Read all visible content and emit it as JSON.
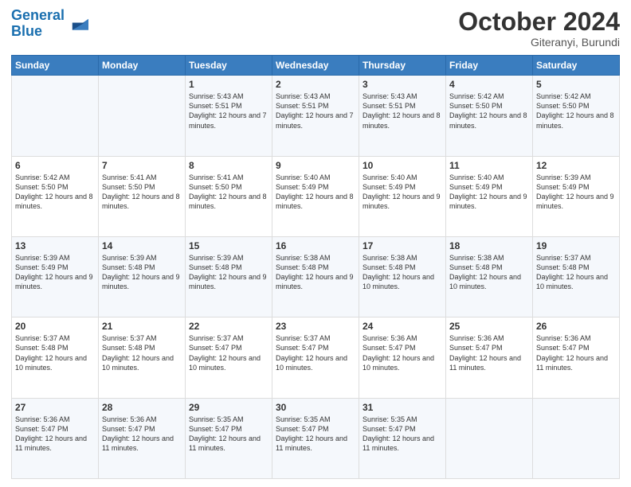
{
  "logo": {
    "line1": "General",
    "line2": "Blue"
  },
  "header": {
    "month": "October 2024",
    "location": "Giteranyi, Burundi"
  },
  "days_of_week": [
    "Sunday",
    "Monday",
    "Tuesday",
    "Wednesday",
    "Thursday",
    "Friday",
    "Saturday"
  ],
  "weeks": [
    [
      {
        "day": "",
        "info": ""
      },
      {
        "day": "",
        "info": ""
      },
      {
        "day": "1",
        "info": "Sunrise: 5:43 AM\nSunset: 5:51 PM\nDaylight: 12 hours and 7 minutes."
      },
      {
        "day": "2",
        "info": "Sunrise: 5:43 AM\nSunset: 5:51 PM\nDaylight: 12 hours and 7 minutes."
      },
      {
        "day": "3",
        "info": "Sunrise: 5:43 AM\nSunset: 5:51 PM\nDaylight: 12 hours and 8 minutes."
      },
      {
        "day": "4",
        "info": "Sunrise: 5:42 AM\nSunset: 5:50 PM\nDaylight: 12 hours and 8 minutes."
      },
      {
        "day": "5",
        "info": "Sunrise: 5:42 AM\nSunset: 5:50 PM\nDaylight: 12 hours and 8 minutes."
      }
    ],
    [
      {
        "day": "6",
        "info": "Sunrise: 5:42 AM\nSunset: 5:50 PM\nDaylight: 12 hours and 8 minutes."
      },
      {
        "day": "7",
        "info": "Sunrise: 5:41 AM\nSunset: 5:50 PM\nDaylight: 12 hours and 8 minutes."
      },
      {
        "day": "8",
        "info": "Sunrise: 5:41 AM\nSunset: 5:50 PM\nDaylight: 12 hours and 8 minutes."
      },
      {
        "day": "9",
        "info": "Sunrise: 5:40 AM\nSunset: 5:49 PM\nDaylight: 12 hours and 8 minutes."
      },
      {
        "day": "10",
        "info": "Sunrise: 5:40 AM\nSunset: 5:49 PM\nDaylight: 12 hours and 9 minutes."
      },
      {
        "day": "11",
        "info": "Sunrise: 5:40 AM\nSunset: 5:49 PM\nDaylight: 12 hours and 9 minutes."
      },
      {
        "day": "12",
        "info": "Sunrise: 5:39 AM\nSunset: 5:49 PM\nDaylight: 12 hours and 9 minutes."
      }
    ],
    [
      {
        "day": "13",
        "info": "Sunrise: 5:39 AM\nSunset: 5:49 PM\nDaylight: 12 hours and 9 minutes."
      },
      {
        "day": "14",
        "info": "Sunrise: 5:39 AM\nSunset: 5:48 PM\nDaylight: 12 hours and 9 minutes."
      },
      {
        "day": "15",
        "info": "Sunrise: 5:39 AM\nSunset: 5:48 PM\nDaylight: 12 hours and 9 minutes."
      },
      {
        "day": "16",
        "info": "Sunrise: 5:38 AM\nSunset: 5:48 PM\nDaylight: 12 hours and 9 minutes."
      },
      {
        "day": "17",
        "info": "Sunrise: 5:38 AM\nSunset: 5:48 PM\nDaylight: 12 hours and 10 minutes."
      },
      {
        "day": "18",
        "info": "Sunrise: 5:38 AM\nSunset: 5:48 PM\nDaylight: 12 hours and 10 minutes."
      },
      {
        "day": "19",
        "info": "Sunrise: 5:37 AM\nSunset: 5:48 PM\nDaylight: 12 hours and 10 minutes."
      }
    ],
    [
      {
        "day": "20",
        "info": "Sunrise: 5:37 AM\nSunset: 5:48 PM\nDaylight: 12 hours and 10 minutes."
      },
      {
        "day": "21",
        "info": "Sunrise: 5:37 AM\nSunset: 5:48 PM\nDaylight: 12 hours and 10 minutes."
      },
      {
        "day": "22",
        "info": "Sunrise: 5:37 AM\nSunset: 5:47 PM\nDaylight: 12 hours and 10 minutes."
      },
      {
        "day": "23",
        "info": "Sunrise: 5:37 AM\nSunset: 5:47 PM\nDaylight: 12 hours and 10 minutes."
      },
      {
        "day": "24",
        "info": "Sunrise: 5:36 AM\nSunset: 5:47 PM\nDaylight: 12 hours and 10 minutes."
      },
      {
        "day": "25",
        "info": "Sunrise: 5:36 AM\nSunset: 5:47 PM\nDaylight: 12 hours and 11 minutes."
      },
      {
        "day": "26",
        "info": "Sunrise: 5:36 AM\nSunset: 5:47 PM\nDaylight: 12 hours and 11 minutes."
      }
    ],
    [
      {
        "day": "27",
        "info": "Sunrise: 5:36 AM\nSunset: 5:47 PM\nDaylight: 12 hours and 11 minutes."
      },
      {
        "day": "28",
        "info": "Sunrise: 5:36 AM\nSunset: 5:47 PM\nDaylight: 12 hours and 11 minutes."
      },
      {
        "day": "29",
        "info": "Sunrise: 5:35 AM\nSunset: 5:47 PM\nDaylight: 12 hours and 11 minutes."
      },
      {
        "day": "30",
        "info": "Sunrise: 5:35 AM\nSunset: 5:47 PM\nDaylight: 12 hours and 11 minutes."
      },
      {
        "day": "31",
        "info": "Sunrise: 5:35 AM\nSunset: 5:47 PM\nDaylight: 12 hours and 11 minutes."
      },
      {
        "day": "",
        "info": ""
      },
      {
        "day": "",
        "info": ""
      }
    ]
  ]
}
